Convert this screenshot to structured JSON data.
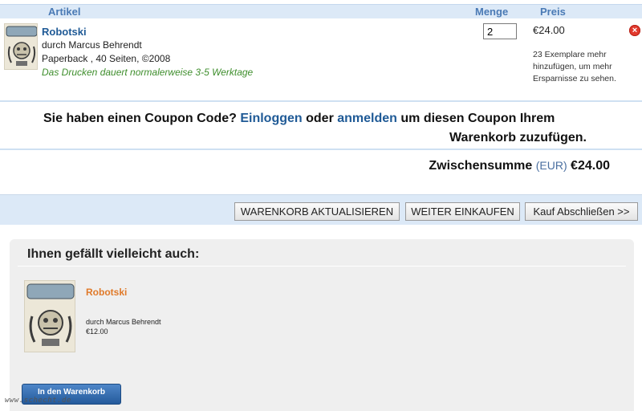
{
  "cart": {
    "headers": {
      "article": "Artikel",
      "quantity": "Menge",
      "price": "Preis"
    },
    "item": {
      "title": "Robotski",
      "author": "durch Marcus Behrendt",
      "meta": "Paperback , 40 Seiten, ©2008",
      "shipping": "Das Drucken dauert normalerweise 3-5 Werktage",
      "quantity": "2",
      "price": "€24.00",
      "note": "23 Exemplare mehr hinzufügen, um mehr Ersparnisse zu sehen.",
      "remove_icon": "close-icon"
    }
  },
  "coupon": {
    "text1": "Sie haben einen Coupon Code? ",
    "login": "Einloggen",
    "text2": " oder ",
    "register": "anmelden",
    "text3": " um diesen Coupon Ihrem",
    "text4": "Warenkorb zuzufügen."
  },
  "subtotal": {
    "label": "Zwischensumme ",
    "currency": "(EUR)",
    "value": " €24.00"
  },
  "actions": {
    "update": "WARENKORB AKTUALISIEREN",
    "continue": "WEITER EINKAUFEN",
    "checkout": "Kauf Abschließen >>"
  },
  "recommendations": {
    "title": "Ihnen gefällt vielleicht auch:",
    "item": {
      "title": "Robotski",
      "author": "durch Marcus Behrendt",
      "price": "€12.00",
      "button": "In den Warenkorb"
    }
  },
  "watermark": "www.schecht.de",
  "colors": {
    "accent": "#1f5a96",
    "header_bg": "#dce9f7",
    "ship_green": "#3e8e2c",
    "rec_orange": "#e07a2a",
    "remove_red": "#e23a2e"
  }
}
